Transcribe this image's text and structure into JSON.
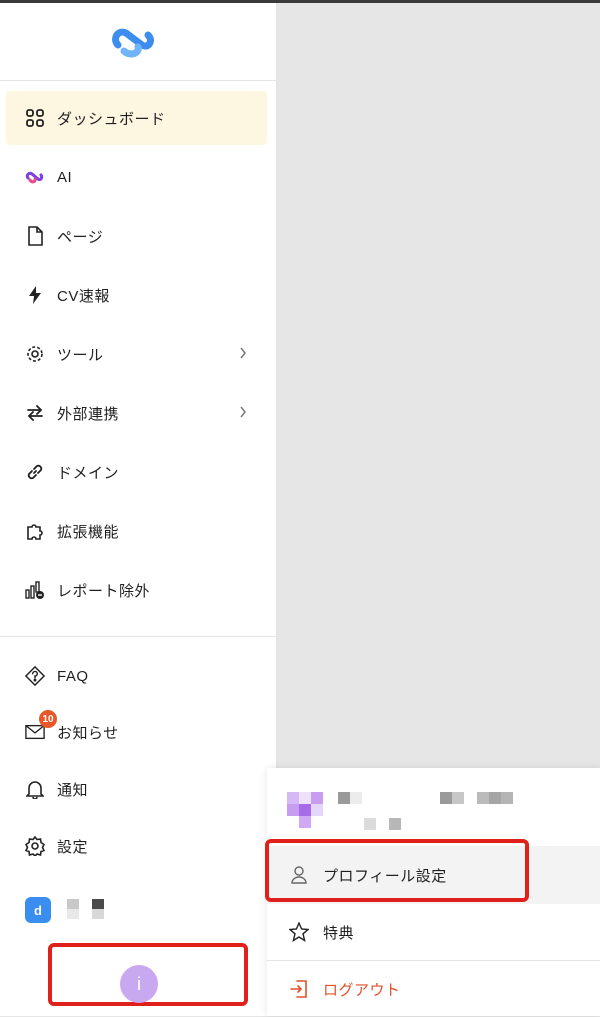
{
  "sidebar": {
    "logo_icon": "app-logo-icon",
    "items": [
      {
        "label": "ダッシュボード",
        "icon": "grid-icon",
        "active": true
      },
      {
        "label": "AI",
        "icon": "ai-logo-icon"
      },
      {
        "label": "ページ",
        "icon": "document-icon"
      },
      {
        "label": "CV速報",
        "icon": "bolt-icon"
      },
      {
        "label": "ツール",
        "icon": "settings-cog-icon",
        "has_submenu": true
      },
      {
        "label": "外部連携",
        "icon": "arrows-swap-icon",
        "has_submenu": true
      },
      {
        "label": "ドメイン",
        "icon": "link-icon"
      },
      {
        "label": "拡張機能",
        "icon": "puzzle-icon"
      },
      {
        "label": "レポート除外",
        "icon": "chart-exclude-icon"
      }
    ],
    "bottom_items": [
      {
        "label": "FAQ",
        "icon": "question-diamond-icon"
      },
      {
        "label": "お知らせ",
        "icon": "mail-icon",
        "badge": "10"
      },
      {
        "label": "通知",
        "icon": "bell-icon"
      },
      {
        "label": "設定",
        "icon": "gear-icon"
      }
    ],
    "user": {
      "avatar_letter": "d"
    },
    "help_button": {
      "label": "i"
    }
  },
  "user_menu": {
    "items": [
      {
        "label": "プロフィール設定",
        "icon": "user-icon"
      },
      {
        "label": "特典",
        "icon": "star-icon"
      },
      {
        "label": "ログアウト",
        "icon": "logout-icon"
      }
    ]
  },
  "colors": {
    "active_bg": "#fdf6e0",
    "badge": "#e8572a",
    "avatar": "#3a8ef0",
    "help_button": "#c9a8f2",
    "logout": "#e0502a",
    "highlight": "#e0201a"
  }
}
